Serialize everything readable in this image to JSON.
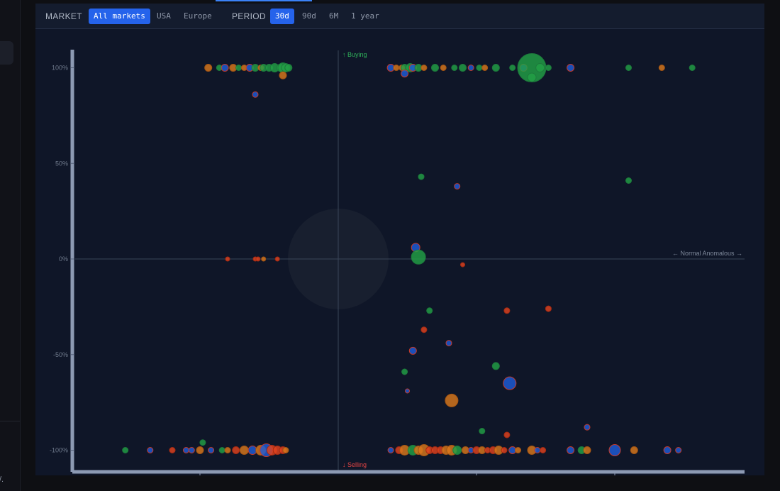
{
  "toolbar": {
    "market_label": "MARKET",
    "market_options": [
      "All markets",
      "USA",
      "Europe"
    ],
    "market_selected": "All markets",
    "period_label": "PERIOD",
    "period_options": [
      "30d",
      "90d",
      "6M",
      "1 year"
    ],
    "period_selected": "30d"
  },
  "chart": {
    "buying_label": "↑ Buying",
    "selling_label": "↓ Selling",
    "axis_annotation": "← Normal Anomalous →",
    "y_ticks": [
      "100%",
      "50%",
      "0%",
      "-50%",
      "-100%"
    ]
  },
  "colors": {
    "buy": "#22a046",
    "sell": "#e0421f",
    "blue": "#1e5bd8",
    "orange": "#d9771c",
    "buy_label": "#2fb05a",
    "sell_label": "#e04444"
  },
  "chart_data": {
    "type": "scatter",
    "xlabel": "",
    "ylabel": "",
    "ylim": [
      -100,
      100
    ],
    "y_tick_values": [
      100,
      50,
      0,
      -50,
      -100
    ],
    "xlim": [
      -1,
      1
    ],
    "x_tick_values": [
      -0.5,
      0.5,
      1
    ],
    "points": [
      {
        "x": -0.47,
        "y": 100,
        "s": 5,
        "c": "orange"
      },
      {
        "x": -0.43,
        "y": 100,
        "s": 4,
        "c": "buy"
      },
      {
        "x": -0.41,
        "y": 100,
        "s": 5,
        "c": "blue"
      },
      {
        "x": -0.38,
        "y": 100,
        "s": 5,
        "c": "orange"
      },
      {
        "x": -0.36,
        "y": 100,
        "s": 4,
        "c": "buy"
      },
      {
        "x": -0.34,
        "y": 100,
        "s": 4,
        "c": "orange"
      },
      {
        "x": -0.32,
        "y": 100,
        "s": 5,
        "c": "blue"
      },
      {
        "x": -0.3,
        "y": 100,
        "s": 5,
        "c": "buy"
      },
      {
        "x": -0.28,
        "y": 100,
        "s": 4,
        "c": "orange"
      },
      {
        "x": -0.27,
        "y": 100,
        "s": 5,
        "c": "buy"
      },
      {
        "x": -0.25,
        "y": 100,
        "s": 5,
        "c": "buy"
      },
      {
        "x": -0.23,
        "y": 100,
        "s": 6,
        "c": "buy"
      },
      {
        "x": -0.21,
        "y": 100,
        "s": 5,
        "c": "buy"
      },
      {
        "x": -0.2,
        "y": 100,
        "s": 7,
        "c": "buy"
      },
      {
        "x": -0.19,
        "y": 100,
        "s": 6,
        "c": "buy"
      },
      {
        "x": -0.18,
        "y": 100,
        "s": 5,
        "c": "buy"
      },
      {
        "x": -0.2,
        "y": 96,
        "s": 5,
        "c": "orange"
      },
      {
        "x": -0.3,
        "y": 86,
        "s": 4,
        "c": "blue"
      },
      {
        "x": 0.19,
        "y": 100,
        "s": 5,
        "c": "blue"
      },
      {
        "x": 0.21,
        "y": 100,
        "s": 4,
        "c": "orange"
      },
      {
        "x": 0.23,
        "y": 100,
        "s": 4,
        "c": "orange"
      },
      {
        "x": 0.24,
        "y": 100,
        "s": 5,
        "c": "buy"
      },
      {
        "x": 0.26,
        "y": 100,
        "s": 6,
        "c": "buy"
      },
      {
        "x": 0.27,
        "y": 100,
        "s": 5,
        "c": "blue"
      },
      {
        "x": 0.29,
        "y": 100,
        "s": 5,
        "c": "buy"
      },
      {
        "x": 0.31,
        "y": 100,
        "s": 4,
        "c": "orange"
      },
      {
        "x": 0.35,
        "y": 100,
        "s": 5,
        "c": "buy"
      },
      {
        "x": 0.38,
        "y": 100,
        "s": 4,
        "c": "orange"
      },
      {
        "x": 0.42,
        "y": 100,
        "s": 4,
        "c": "buy"
      },
      {
        "x": 0.45,
        "y": 100,
        "s": 5,
        "c": "buy"
      },
      {
        "x": 0.48,
        "y": 100,
        "s": 4,
        "c": "blue"
      },
      {
        "x": 0.51,
        "y": 100,
        "s": 4,
        "c": "buy"
      },
      {
        "x": 0.53,
        "y": 100,
        "s": 4,
        "c": "orange"
      },
      {
        "x": 0.57,
        "y": 100,
        "s": 5,
        "c": "buy"
      },
      {
        "x": 0.63,
        "y": 100,
        "s": 4,
        "c": "buy"
      },
      {
        "x": 0.67,
        "y": 100,
        "s": 5,
        "c": "blue"
      },
      {
        "x": 0.7,
        "y": 100,
        "s": 20,
        "c": "buy"
      },
      {
        "x": 0.73,
        "y": 100,
        "s": 6,
        "c": "buy"
      },
      {
        "x": 0.76,
        "y": 100,
        "s": 4,
        "c": "buy"
      },
      {
        "x": 0.84,
        "y": 100,
        "s": 5,
        "c": "blue"
      },
      {
        "x": 1.05,
        "y": 100,
        "s": 4,
        "c": "buy"
      },
      {
        "x": 1.17,
        "y": 100,
        "s": 4,
        "c": "orange"
      },
      {
        "x": 1.28,
        "y": 100,
        "s": 4,
        "c": "buy"
      },
      {
        "x": 0.24,
        "y": 97,
        "s": 5,
        "c": "blue"
      },
      {
        "x": 0.7,
        "y": 95,
        "s": 6,
        "c": "buy"
      },
      {
        "x": 0.3,
        "y": 43,
        "s": 4,
        "c": "buy"
      },
      {
        "x": 0.43,
        "y": 38,
        "s": 4,
        "c": "blue"
      },
      {
        "x": 1.05,
        "y": 41,
        "s": 4,
        "c": "buy"
      },
      {
        "x": -0.3,
        "y": 0,
        "s": 3,
        "c": "sell"
      },
      {
        "x": -0.22,
        "y": 0,
        "s": 3,
        "c": "sell"
      },
      {
        "x": -0.27,
        "y": 0,
        "s": 3,
        "c": "orange"
      },
      {
        "x": -0.29,
        "y": 0,
        "s": 3,
        "c": "sell"
      },
      {
        "x": -0.4,
        "y": 0,
        "s": 3,
        "c": "sell"
      },
      {
        "x": 0.28,
        "y": 6,
        "s": 6,
        "c": "blue"
      },
      {
        "x": 0.29,
        "y": 1,
        "s": 10,
        "c": "buy"
      },
      {
        "x": 0.45,
        "y": -3,
        "s": 3,
        "c": "sell"
      },
      {
        "x": 0.33,
        "y": -27,
        "s": 4,
        "c": "buy"
      },
      {
        "x": 0.61,
        "y": -27,
        "s": 4,
        "c": "sell"
      },
      {
        "x": 0.76,
        "y": -26,
        "s": 4,
        "c": "sell"
      },
      {
        "x": 0.31,
        "y": -37,
        "s": 4,
        "c": "sell"
      },
      {
        "x": 0.4,
        "y": -44,
        "s": 4,
        "c": "blue"
      },
      {
        "x": 0.27,
        "y": -48,
        "s": 5,
        "c": "blue"
      },
      {
        "x": 0.24,
        "y": -59,
        "s": 4,
        "c": "buy"
      },
      {
        "x": 0.57,
        "y": -56,
        "s": 5,
        "c": "buy"
      },
      {
        "x": 0.25,
        "y": -69,
        "s": 3,
        "c": "blue"
      },
      {
        "x": 0.62,
        "y": -65,
        "s": 9,
        "c": "blue"
      },
      {
        "x": 0.41,
        "y": -74,
        "s": 9,
        "c": "orange"
      },
      {
        "x": 0.52,
        "y": -90,
        "s": 4,
        "c": "buy"
      },
      {
        "x": 0.61,
        "y": -92,
        "s": 4,
        "c": "sell"
      },
      {
        "x": 0.9,
        "y": -88,
        "s": 4,
        "c": "blue"
      },
      {
        "x": -0.77,
        "y": -100,
        "s": 4,
        "c": "buy"
      },
      {
        "x": -0.68,
        "y": -100,
        "s": 4,
        "c": "blue"
      },
      {
        "x": -0.6,
        "y": -100,
        "s": 4,
        "c": "sell"
      },
      {
        "x": -0.55,
        "y": -100,
        "s": 4,
        "c": "blue"
      },
      {
        "x": -0.53,
        "y": -100,
        "s": 4,
        "c": "blue"
      },
      {
        "x": -0.5,
        "y": -100,
        "s": 5,
        "c": "orange"
      },
      {
        "x": -0.46,
        "y": -100,
        "s": 4,
        "c": "blue"
      },
      {
        "x": -0.42,
        "y": -100,
        "s": 4,
        "c": "buy"
      },
      {
        "x": -0.4,
        "y": -100,
        "s": 4,
        "c": "orange"
      },
      {
        "x": -0.37,
        "y": -100,
        "s": 5,
        "c": "sell"
      },
      {
        "x": -0.34,
        "y": -100,
        "s": 6,
        "c": "orange"
      },
      {
        "x": -0.31,
        "y": -100,
        "s": 6,
        "c": "blue"
      },
      {
        "x": -0.28,
        "y": -100,
        "s": 7,
        "c": "orange"
      },
      {
        "x": -0.26,
        "y": -100,
        "s": 9,
        "c": "blue"
      },
      {
        "x": -0.24,
        "y": -100,
        "s": 7,
        "c": "sell"
      },
      {
        "x": -0.22,
        "y": -100,
        "s": 6,
        "c": "sell"
      },
      {
        "x": -0.2,
        "y": -100,
        "s": 5,
        "c": "sell"
      },
      {
        "x": -0.19,
        "y": -100,
        "s": 4,
        "c": "orange"
      },
      {
        "x": -0.49,
        "y": -96,
        "s": 4,
        "c": "buy"
      },
      {
        "x": 0.19,
        "y": -100,
        "s": 4,
        "c": "blue"
      },
      {
        "x": 0.22,
        "y": -100,
        "s": 5,
        "c": "sell"
      },
      {
        "x": 0.24,
        "y": -100,
        "s": 7,
        "c": "orange"
      },
      {
        "x": 0.27,
        "y": -100,
        "s": 7,
        "c": "buy"
      },
      {
        "x": 0.29,
        "y": -100,
        "s": 6,
        "c": "orange"
      },
      {
        "x": 0.31,
        "y": -100,
        "s": 8,
        "c": "orange"
      },
      {
        "x": 0.33,
        "y": -100,
        "s": 5,
        "c": "sell"
      },
      {
        "x": 0.35,
        "y": -100,
        "s": 5,
        "c": "sell"
      },
      {
        "x": 0.37,
        "y": -100,
        "s": 5,
        "c": "sell"
      },
      {
        "x": 0.39,
        "y": -100,
        "s": 6,
        "c": "orange"
      },
      {
        "x": 0.41,
        "y": -100,
        "s": 7,
        "c": "orange"
      },
      {
        "x": 0.43,
        "y": -100,
        "s": 6,
        "c": "buy"
      },
      {
        "x": 0.46,
        "y": -100,
        "s": 5,
        "c": "orange"
      },
      {
        "x": 0.48,
        "y": -100,
        "s": 4,
        "c": "blue"
      },
      {
        "x": 0.5,
        "y": -100,
        "s": 5,
        "c": "sell"
      },
      {
        "x": 0.52,
        "y": -100,
        "s": 5,
        "c": "orange"
      },
      {
        "x": 0.54,
        "y": -100,
        "s": 4,
        "c": "sell"
      },
      {
        "x": 0.56,
        "y": -100,
        "s": 5,
        "c": "sell"
      },
      {
        "x": 0.58,
        "y": -100,
        "s": 6,
        "c": "orange"
      },
      {
        "x": 0.6,
        "y": -100,
        "s": 4,
        "c": "sell"
      },
      {
        "x": 0.63,
        "y": -100,
        "s": 5,
        "c": "blue"
      },
      {
        "x": 0.65,
        "y": -100,
        "s": 4,
        "c": "orange"
      },
      {
        "x": 0.7,
        "y": -100,
        "s": 6,
        "c": "orange"
      },
      {
        "x": 0.72,
        "y": -100,
        "s": 4,
        "c": "blue"
      },
      {
        "x": 0.74,
        "y": -100,
        "s": 4,
        "c": "sell"
      },
      {
        "x": 0.84,
        "y": -100,
        "s": 5,
        "c": "blue"
      },
      {
        "x": 0.88,
        "y": -100,
        "s": 5,
        "c": "buy"
      },
      {
        "x": 0.9,
        "y": -100,
        "s": 5,
        "c": "orange"
      },
      {
        "x": 1.0,
        "y": -100,
        "s": 8,
        "c": "blue"
      },
      {
        "x": 1.07,
        "y": -100,
        "s": 5,
        "c": "orange"
      },
      {
        "x": 1.19,
        "y": -100,
        "s": 5,
        "c": "blue"
      },
      {
        "x": 1.23,
        "y": -100,
        "s": 4,
        "c": "blue"
      }
    ]
  }
}
